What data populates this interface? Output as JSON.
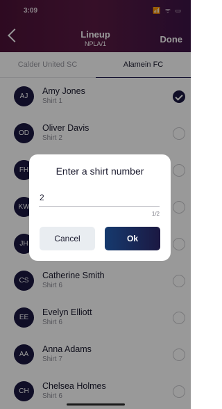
{
  "status_bar": {
    "time": "3:09",
    "icons": "📶 ᯤ ▭"
  },
  "header": {
    "title": "Lineup",
    "subtitle": "NPLA/1",
    "done_label": "Done"
  },
  "tabs": [
    {
      "label": "Calder United SC",
      "active": false
    },
    {
      "label": "Alamein FC",
      "active": true
    }
  ],
  "players": [
    {
      "initials": "AJ",
      "name": "Amy Jones",
      "shirt": "Shirt 1",
      "selected": true
    },
    {
      "initials": "OD",
      "name": "Oliver Davis",
      "shirt": "Shirt 2",
      "selected": false
    },
    {
      "initials": "FH",
      "name": "",
      "shirt": "",
      "selected": false
    },
    {
      "initials": "KW",
      "name": "",
      "shirt": "",
      "selected": false
    },
    {
      "initials": "JH",
      "name": "",
      "shirt": "",
      "selected": false
    },
    {
      "initials": "CS",
      "name": "Catherine Smith",
      "shirt": "Shirt 6",
      "selected": false
    },
    {
      "initials": "EE",
      "name": "Evelyn Elliott",
      "shirt": "Shirt 6",
      "selected": false
    },
    {
      "initials": "AA",
      "name": "Anna Adams",
      "shirt": "Shirt 7",
      "selected": false
    },
    {
      "initials": "CH",
      "name": "Chelsea Holmes",
      "shirt": "Shirt 6",
      "selected": false
    }
  ],
  "dialog": {
    "title": "Enter a shirt number",
    "input_value": "2",
    "counter": "1/2",
    "cancel_label": "Cancel",
    "ok_label": "Ok"
  },
  "colors": {
    "header": "#4d1238",
    "accent": "#1b1842",
    "ok_gradient_start": "#163a6e"
  }
}
